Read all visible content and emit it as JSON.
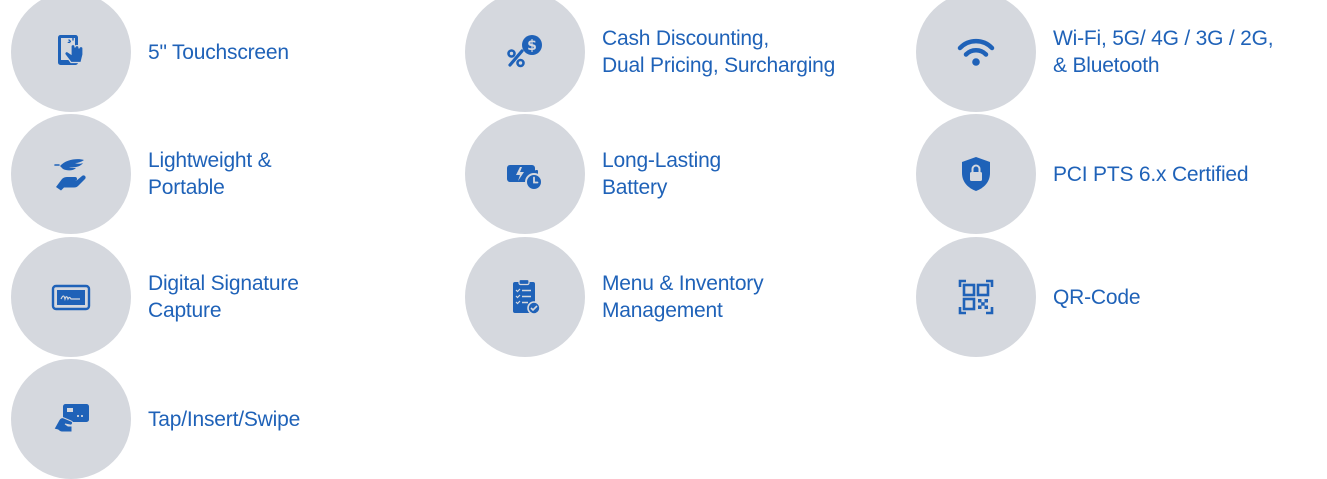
{
  "colors": {
    "accent": "#1f62b8",
    "circle_bg": "#d5d8de",
    "background": "#ffffff"
  },
  "features": [
    {
      "icon": "touchscreen-icon",
      "lines": [
        "5\" Touchscreen"
      ]
    },
    {
      "icon": "percent-dollar-icon",
      "lines": [
        "Cash Discounting,",
        "Dual Pricing, Surcharging"
      ]
    },
    {
      "icon": "wifi-icon",
      "lines": [
        "Wi-Fi, 5G/ 4G / 3G / 2G,",
        "& Bluetooth"
      ]
    },
    {
      "icon": "hand-feather-icon",
      "lines": [
        "Lightweight &",
        "Portable"
      ]
    },
    {
      "icon": "battery-clock-icon",
      "lines": [
        "Long-Lasting",
        "Battery"
      ]
    },
    {
      "icon": "shield-lock-icon",
      "lines": [
        "PCI PTS 6.x Certified"
      ]
    },
    {
      "icon": "signature-tablet-icon",
      "lines": [
        "Digital Signature",
        "Capture"
      ]
    },
    {
      "icon": "clipboard-checklist-icon",
      "lines": [
        "Menu & Inventory",
        "Management"
      ]
    },
    {
      "icon": "qr-code-icon",
      "lines": [
        "QR-Code"
      ]
    },
    {
      "icon": "card-tap-icon",
      "lines": [
        "Tap/Insert/Swipe"
      ]
    }
  ]
}
